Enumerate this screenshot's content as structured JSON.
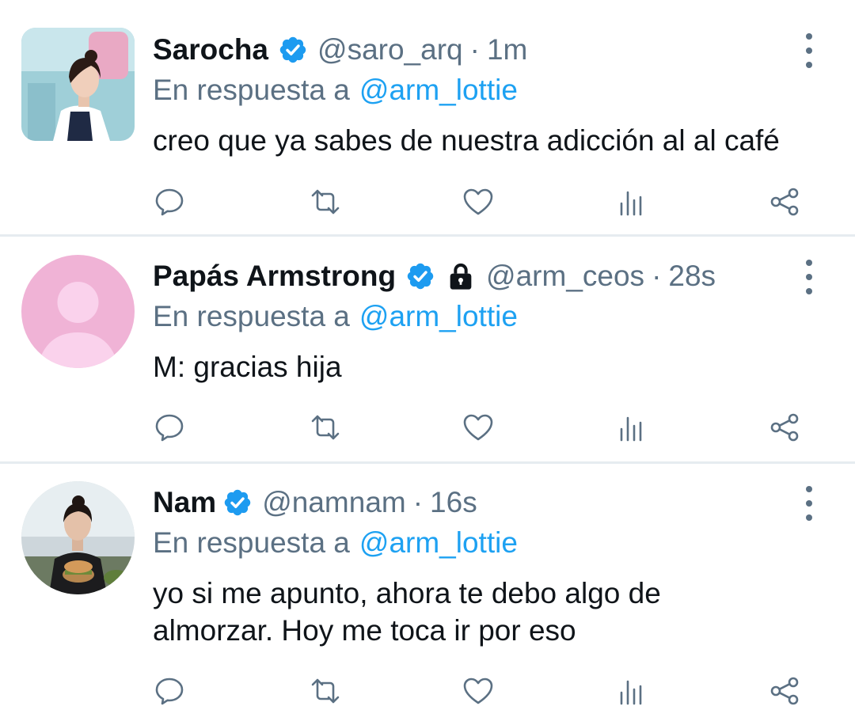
{
  "tweets": [
    {
      "name": "Sarocha",
      "handle": "@saro_arq",
      "separator": "·",
      "time": "1m",
      "reply_prefix": "En respuesta a",
      "reply_to": "@arm_lottie",
      "text": "creo que ya sabes de nuestra adicción al al café",
      "verified": true,
      "locked": false
    },
    {
      "name": "Papás Armstrong",
      "handle": "@arm_ceos",
      "separator": "·",
      "time": "28s",
      "reply_prefix": "En respuesta a",
      "reply_to": "@arm_lottie",
      "text": "M: gracias hija",
      "verified": true,
      "locked": true
    },
    {
      "name": "Nam",
      "handle": "@namnam",
      "separator": "·",
      "time": "16s",
      "reply_prefix": "En respuesta a",
      "reply_to": "@arm_lottie",
      "text": "yo si me apunto, ahora te debo algo de almorzar. Hoy me toca ir por eso",
      "verified": true,
      "locked": false
    }
  ],
  "colors": {
    "text": "#0f1419",
    "secondary": "#5b7083",
    "link": "#1da1f2",
    "verified": "#1d9bf0",
    "divider": "#e6ecf0",
    "default_avatar": "#f0b3d6"
  },
  "icons": [
    "verified-badge-icon",
    "lock-icon",
    "more-options-icon",
    "reply-icon",
    "retweet-icon",
    "like-icon",
    "analytics-icon",
    "share-icon"
  ]
}
